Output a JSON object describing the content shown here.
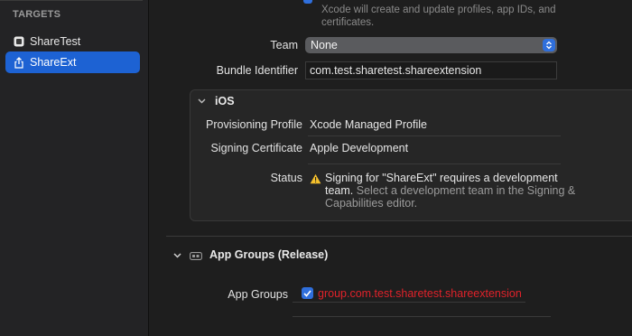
{
  "sidebar": {
    "heading": "TARGETS",
    "items": [
      {
        "label": "ShareTest",
        "icon": "app-target-icon",
        "selected": false
      },
      {
        "label": "ShareExt",
        "icon": "share-extension-icon",
        "selected": true
      }
    ]
  },
  "signing": {
    "hint": "Xcode will create and update profiles, app IDs, and certificates.",
    "team_label": "Team",
    "team_value": "None",
    "bundle_label": "Bundle Identifier",
    "bundle_value": "com.test.sharetest.shareextension"
  },
  "ios_panel": {
    "title": "iOS",
    "profile_label": "Provisioning Profile",
    "profile_value": "Xcode Managed Profile",
    "certificate_label": "Signing Certificate",
    "certificate_value": "Apple Development",
    "status_label": "Status",
    "status_bold": "Signing for \"ShareExt\" requires a development team.",
    "status_muted": "Select a development team in the Signing & Capabilities editor."
  },
  "app_groups": {
    "section_title": "App Groups (Release)",
    "label": "App Groups",
    "items": [
      {
        "value": "group.com.test.sharetest.shareextension",
        "checked": true
      }
    ]
  },
  "colors": {
    "accent": "#2f6fdc",
    "selection": "#1d62d3",
    "error_text": "#e0222a",
    "warning": "#f5c02c"
  }
}
